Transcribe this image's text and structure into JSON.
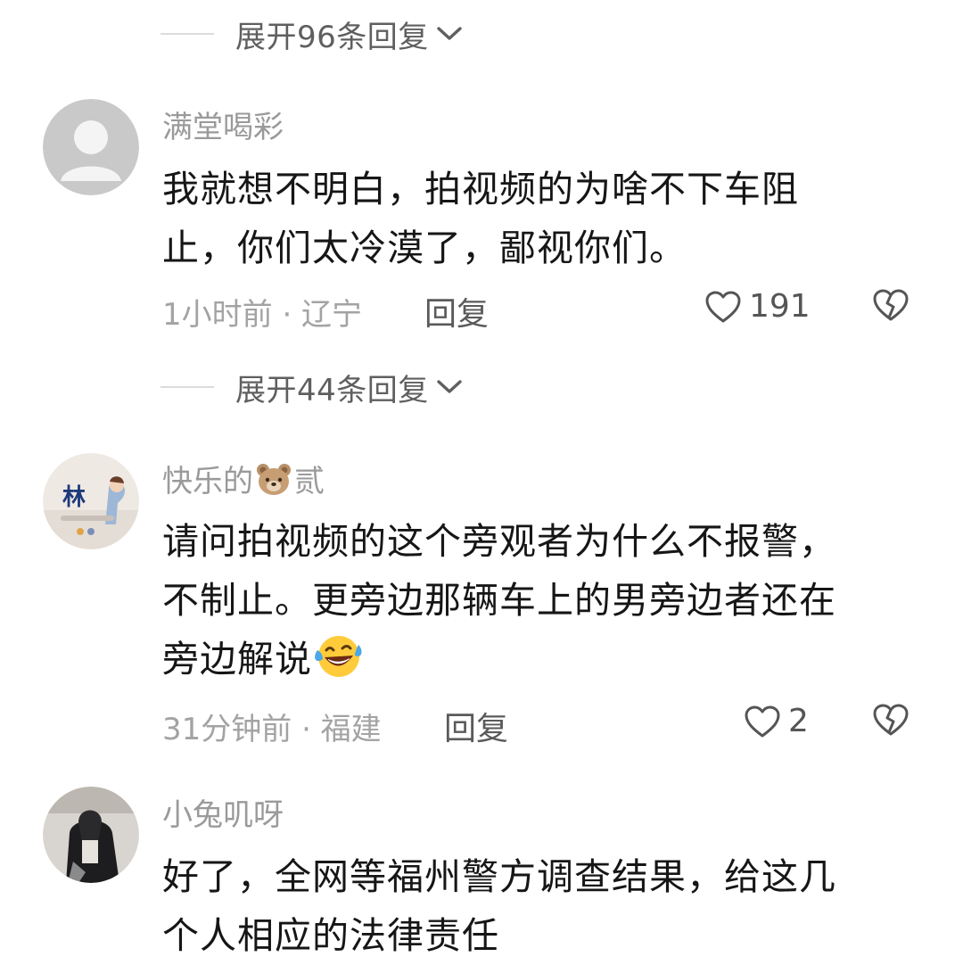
{
  "expand_1": {
    "label": "展开96条回复"
  },
  "expand_2": {
    "label": "展开44条回复"
  },
  "comments": [
    {
      "username": "满堂喝彩",
      "lines": [
        "我就想不明白，拍视频的为啥不下车阻",
        "止，你们太冷漠了，鄙视你们。"
      ],
      "meta": "1小时前 · 辽宁",
      "reply": "回复",
      "likes": "191"
    },
    {
      "username_prefix": "快乐的",
      "username_suffix": "贰",
      "username_emoji": "bear-face-icon",
      "lines": [
        "请问拍视频的这个旁观者为什么不报警，",
        "不制止。更旁边那辆车上的男旁边者还在",
        "旁边解说"
      ],
      "content_emoji": "laughing-tears-icon",
      "meta": "31分钟前 · 福建",
      "reply": "回复",
      "likes": "2"
    },
    {
      "username": "小兔叽呀",
      "lines": [
        "好了，全网等福州警方调查结果，给这几",
        "个人相应的法律责任"
      ]
    }
  ],
  "colors": {
    "username": "#9a9a9a",
    "content": "#161616",
    "meta": "#a3a3a3",
    "divider": "#dcdcdc"
  }
}
